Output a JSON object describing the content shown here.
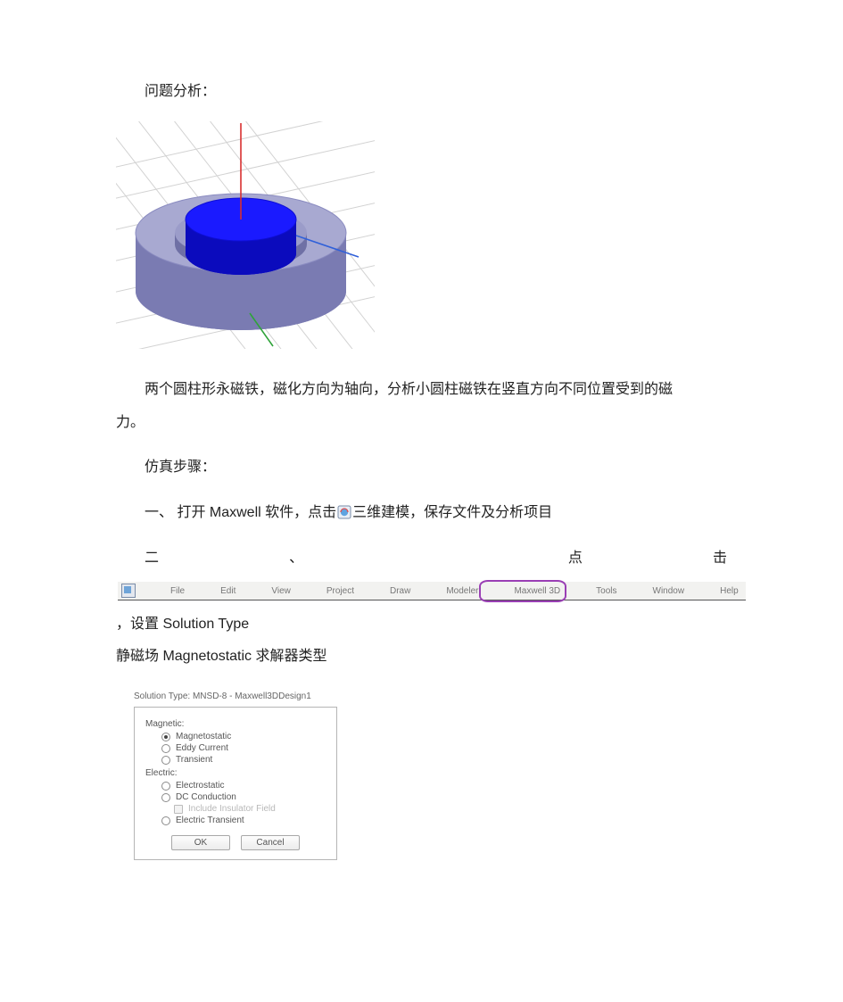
{
  "headings": {
    "problem": "问题分析：",
    "steps": "仿真步骤："
  },
  "paragraphs": {
    "description_full": "两个圆柱形永磁铁，磁化方向为轴向，分析小圆柱磁铁在竖直方向不同位置受到的磁力。",
    "description_line1": "两个圆柱形永磁铁，磁化方向为轴向，分析小圆柱磁铁在竖直方向不同位置受到的磁",
    "description_line2": "力。"
  },
  "steps": {
    "one": {
      "prefix": "一、  打开 Maxwell 软件，点击",
      "suffix": "三维建模，保存文件及分析项目"
    },
    "two": {
      "prefix": "二、  点击",
      "suffix_a": "，设置 Solution Type",
      "line2": "静磁场 Magnetostatic 求解器类型"
    }
  },
  "menubar": {
    "items": [
      "File",
      "Edit",
      "View",
      "Project",
      "Draw",
      "Modeler",
      "Maxwell 3D",
      "Tools",
      "Window",
      "Help"
    ],
    "highlighted_index": 6
  },
  "dialog": {
    "title": "Solution Type: MNSD-8 - Maxwell3DDesign1",
    "groups": [
      {
        "label": "Magnetic:",
        "options": [
          {
            "label": "Magnetostatic",
            "selected": true,
            "type": "radio"
          },
          {
            "label": "Eddy Current",
            "selected": false,
            "type": "radio"
          },
          {
            "label": "Transient",
            "selected": false,
            "type": "radio"
          }
        ]
      },
      {
        "label": "Electric:",
        "options": [
          {
            "label": "Electrostatic",
            "selected": false,
            "type": "radio"
          },
          {
            "label": "DC Conduction",
            "selected": false,
            "type": "radio"
          },
          {
            "label": "Include Insulator Field",
            "selected": false,
            "type": "checkbox",
            "disabled": true
          },
          {
            "label": "Electric Transient",
            "selected": false,
            "type": "radio"
          }
        ]
      }
    ],
    "buttons": {
      "ok": "OK",
      "cancel": "Cancel"
    }
  }
}
